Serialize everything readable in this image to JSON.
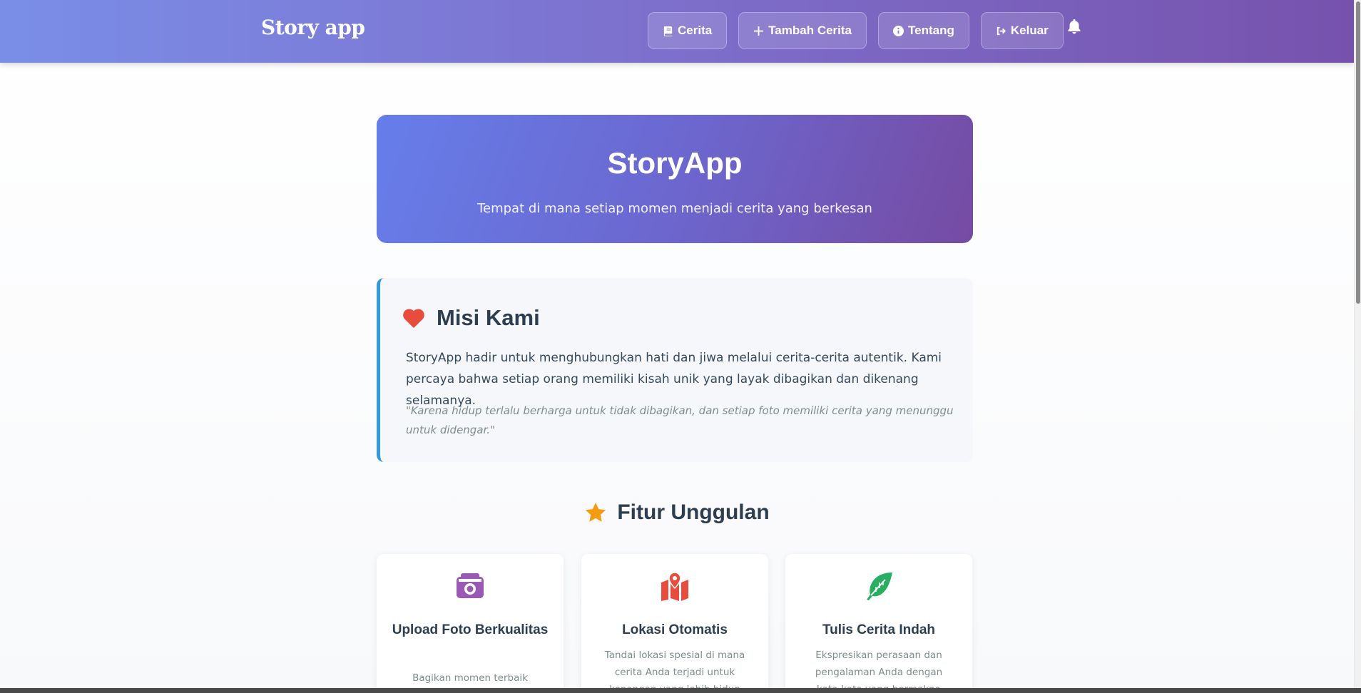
{
  "header": {
    "brand": "Story app",
    "nav": [
      {
        "label": "Cerita",
        "icon": "book-icon"
      },
      {
        "label": "Tambah Cerita",
        "icon": "plus-icon"
      },
      {
        "label": "Tentang",
        "icon": "info-icon"
      },
      {
        "label": "Keluar",
        "icon": "sign-out-icon"
      }
    ],
    "notification_icon": "bell-icon"
  },
  "hero": {
    "title": "StoryApp",
    "subtitle": "Tempat di mana setiap momen menjadi cerita yang berkesan"
  },
  "mission": {
    "icon": "heart-icon",
    "title": "Misi Kami",
    "text": "StoryApp hadir untuk menghubungkan hati dan jiwa melalui cerita-cerita autentik. Kami percaya bahwa setiap orang memiliki kisah unik yang layak dibagikan dan dikenang selamanya.",
    "quote": "\"Karena hidup terlalu berharga untuk tidak dibagikan, dan setiap foto memiliki cerita yang menunggu untuk didengar.\""
  },
  "features": {
    "icon": "star-icon",
    "title": "Fitur Unggulan",
    "items": [
      {
        "icon": "camera-icon",
        "title": "Upload Foto Berkualitas",
        "desc": "Bagikan momen terbaik dengan"
      },
      {
        "icon": "map-location-icon",
        "title": "Lokasi Otomatis",
        "desc": "Tandai lokasi spesial di mana cerita Anda terjadi untuk kenangan yang lebih hidup"
      },
      {
        "icon": "feather-icon",
        "title": "Tulis Cerita Indah",
        "desc": "Ekspresikan perasaan dan pengalaman Anda dengan kata-kata yang bermakna"
      }
    ]
  },
  "colors": {
    "header_gradient_start": "#7a8ee8",
    "header_gradient_end": "#7652ad",
    "hero_gradient_start": "#667eea",
    "hero_gradient_end": "#764ba2",
    "mission_accent": "#3498db",
    "heart": "#e74c3c",
    "star": "#f39c12",
    "camera": "#9b59b6",
    "map": "#e74c3c",
    "feather": "#27ae60"
  }
}
